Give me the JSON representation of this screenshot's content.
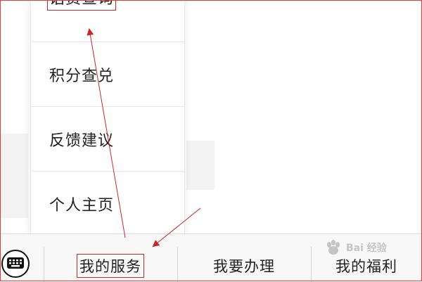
{
  "menu": {
    "items": [
      {
        "label": "话费查询"
      },
      {
        "label": "积分查兑"
      },
      {
        "label": "反馈建议"
      },
      {
        "label": "个人主页"
      }
    ]
  },
  "bottom_bar": {
    "keyboard_icon": "keyboard-icon",
    "tabs": [
      {
        "label": "我的服务"
      },
      {
        "label": "我要办理"
      },
      {
        "label": "我的福利"
      }
    ]
  },
  "watermark": {
    "text": "Bai 经验"
  },
  "colors": {
    "annotation": "#c62828",
    "bar_bg": "#f8f8f8",
    "divider": "#e6e6e6"
  }
}
